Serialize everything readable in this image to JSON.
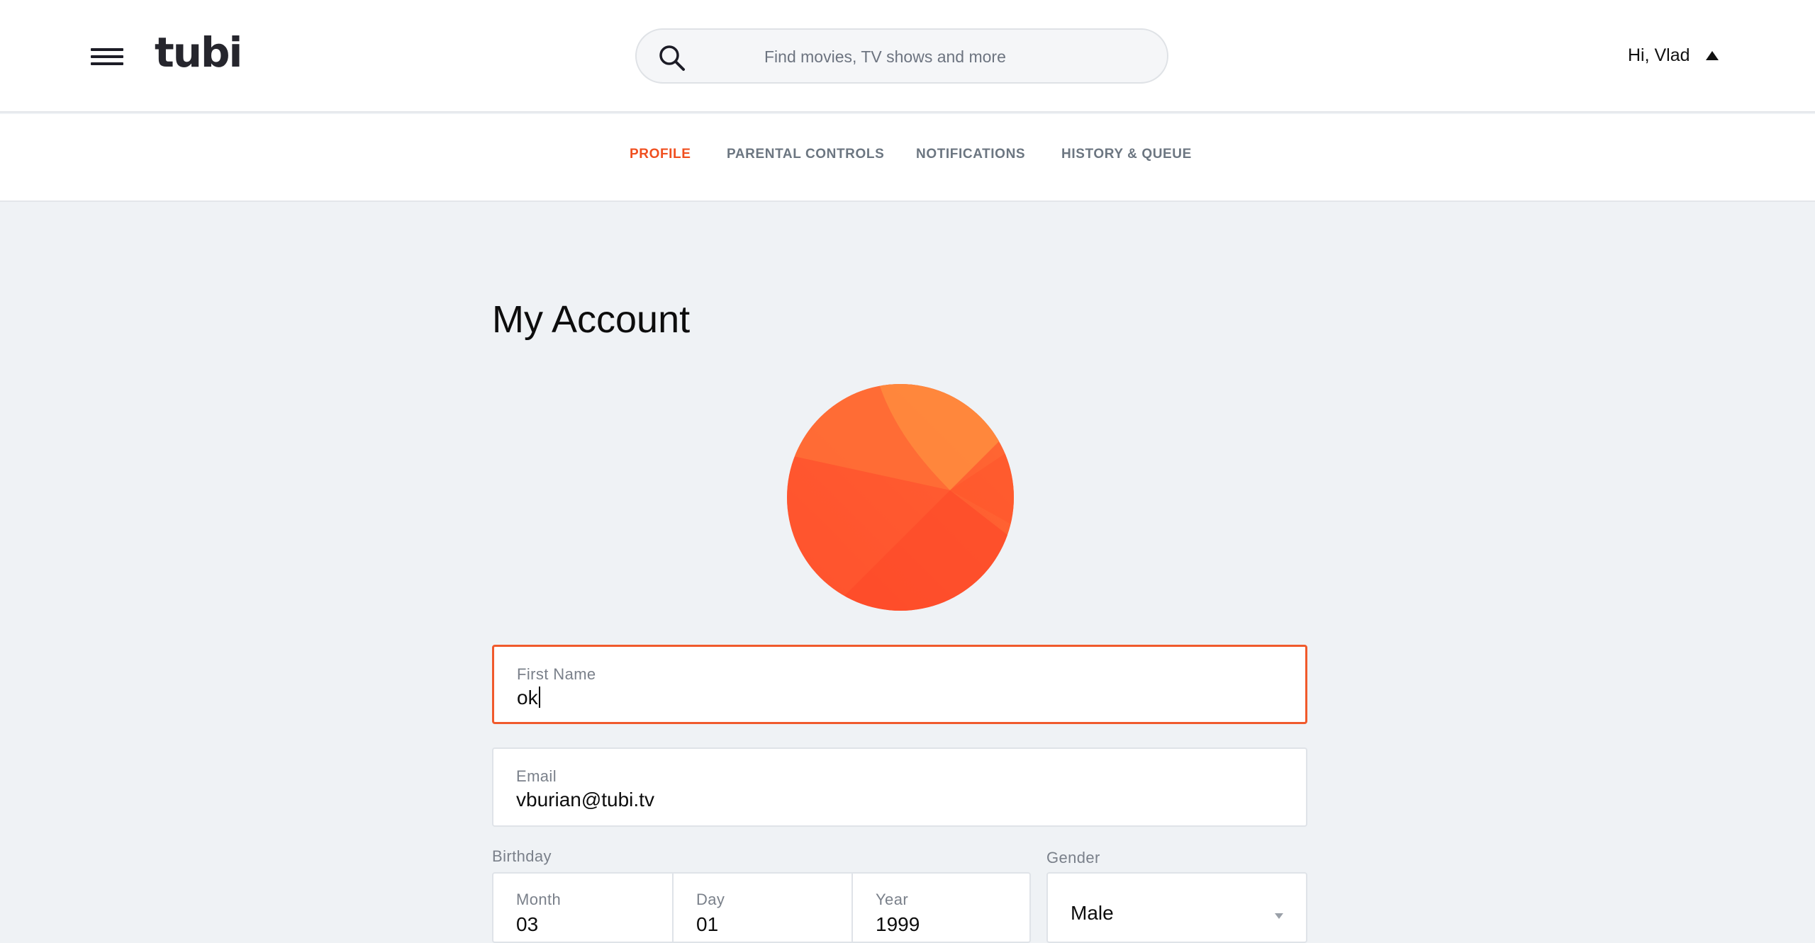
{
  "header": {
    "logo": "tubi",
    "search_placeholder": "Find movies, TV shows and more",
    "greeting": "Hi, Vlad"
  },
  "tabs": [
    {
      "label": "PROFILE",
      "active": true
    },
    {
      "label": "PARENTAL CONTROLS",
      "active": false
    },
    {
      "label": "NOTIFICATIONS",
      "active": false
    },
    {
      "label": "HISTORY & QUEUE",
      "active": false
    }
  ],
  "page": {
    "title": "My Account"
  },
  "form": {
    "first_name": {
      "label": "First Name",
      "value": "ok"
    },
    "email": {
      "label": "Email",
      "value": "vburian@tubi.tv"
    },
    "birthday": {
      "label": "Birthday",
      "month": {
        "label": "Month",
        "value": "03"
      },
      "day": {
        "label": "Day",
        "value": "01"
      },
      "year": {
        "label": "Year",
        "value": "1999"
      }
    },
    "gender": {
      "label": "Gender",
      "value": "Male"
    }
  },
  "colors": {
    "accent": "#f04f1f",
    "avatar_primary": "#fe5a30",
    "avatar_light": "#ff8a3d"
  }
}
